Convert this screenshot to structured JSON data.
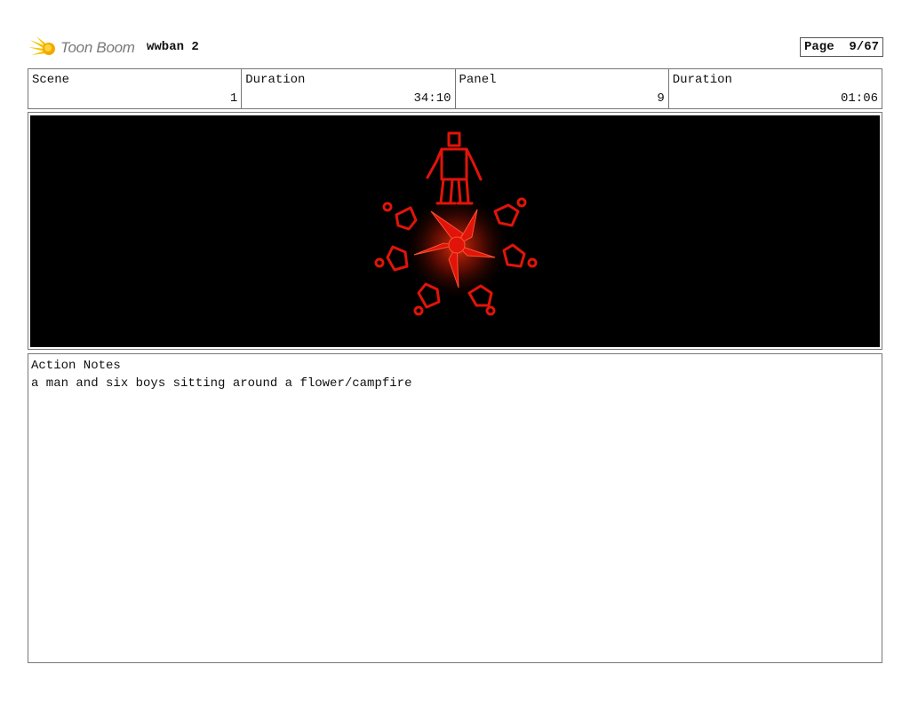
{
  "header": {
    "brand": "Toon Boom",
    "project_title": "wwban 2",
    "page_label": "Page  9/67"
  },
  "info": {
    "scene_label": "Scene",
    "scene_value": "1",
    "scene_duration_label": "Duration",
    "scene_duration_value": "34:10",
    "panel_label": "Panel",
    "panel_value": "9",
    "panel_duration_label": "Duration",
    "panel_duration_value": "01:06"
  },
  "panel_image": {
    "background": "#000000",
    "stroke_color": "#e0140a",
    "glow_color": "#ff3a10"
  },
  "notes": {
    "title": "Action Notes",
    "text": "a man and six boys sitting around a flower/campfire"
  }
}
